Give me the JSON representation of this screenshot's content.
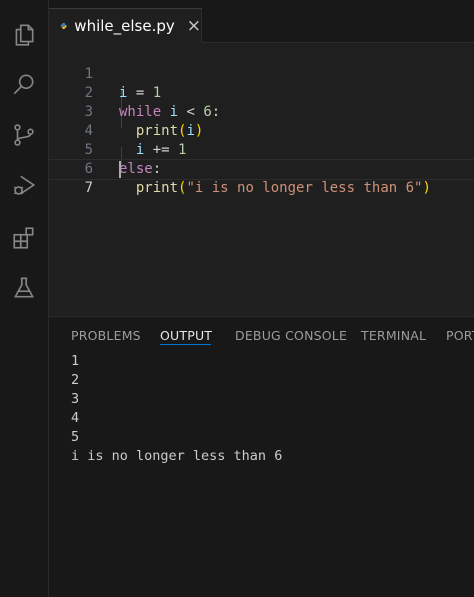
{
  "activity_bar": {
    "items": [
      {
        "icon": "files-icon",
        "label": "Explorer"
      },
      {
        "icon": "search-icon",
        "label": "Search"
      },
      {
        "icon": "source-control-icon",
        "label": "Source Control"
      },
      {
        "icon": "run-debug-icon",
        "label": "Run and Debug"
      },
      {
        "icon": "extensions-icon",
        "label": "Extensions"
      },
      {
        "icon": "testing-icon",
        "label": "Testing"
      }
    ]
  },
  "editor": {
    "tab": {
      "title": "while_else.py",
      "close_glyph": "×",
      "icon": "python-icon"
    },
    "line_numbers": [
      "1",
      "2",
      "3",
      "4",
      "5",
      "6",
      "7"
    ],
    "lines": {
      "l1": {
        "var": "i",
        "op": " = ",
        "num": "1"
      },
      "l2": {
        "kw": "while",
        "var": "i",
        "op": " < ",
        "num": "6",
        "colon": ":"
      },
      "l3": {
        "fn": "print",
        "open": "(",
        "var": "i",
        "close": ")"
      },
      "l4": {
        "var": "i",
        "op": " += ",
        "num": "1"
      },
      "l5": {
        "kw": "else",
        "colon": ":"
      },
      "l6": {
        "fn": "print",
        "open": "(",
        "str": "\"i is no longer less than 6\"",
        "close": ")"
      },
      "l7": {}
    }
  },
  "panel": {
    "tabs": [
      "PROBLEMS",
      "OUTPUT",
      "DEBUG CONSOLE",
      "TERMINAL",
      "PORT"
    ],
    "active_tab": "OUTPUT",
    "output_lines": [
      "1",
      "2",
      "3",
      "4",
      "5",
      "i is no longer less than 6"
    ]
  },
  "colors": {
    "keyword": "#c586c0",
    "variable": "#9cdcfe",
    "number": "#b5cea8",
    "function": "#dcdcaa",
    "string": "#ce9178",
    "accent": "#0078d4"
  }
}
